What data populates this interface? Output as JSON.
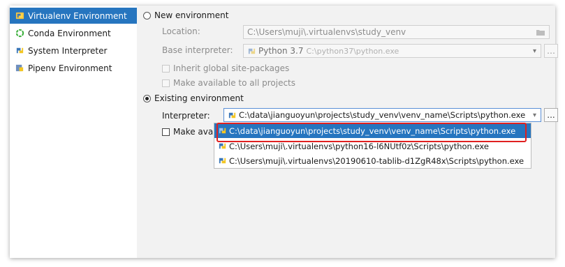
{
  "sidebar": {
    "items": [
      {
        "label": "Virtualenv Environment",
        "icon": "virtualenv-icon",
        "selected": true
      },
      {
        "label": "Conda Environment",
        "icon": "conda-icon",
        "selected": false
      },
      {
        "label": "System Interpreter",
        "icon": "python-icon",
        "selected": false
      },
      {
        "label": "Pipenv Environment",
        "icon": "pipenv-icon",
        "selected": false
      }
    ]
  },
  "new_env": {
    "label": "New environment",
    "location_label": "Location:",
    "location_value": "C:\\Users\\muji\\.virtualenvs\\study_venv",
    "base_label": "Base interpreter:",
    "base_value_name": "Python 3.7",
    "base_value_path": "C:\\python37\\python.exe",
    "inherit_label": "Inherit global site-packages",
    "available_label": "Make available to all projects"
  },
  "existing_env": {
    "label": "Existing environment",
    "interpreter_label": "Interpreter:",
    "interpreter_value": "C:\\data\\jianguoyun\\projects\\study_venv\\venv_name\\Scripts\\python.exe",
    "make_available_label": "Make avail",
    "browse_label": "..."
  },
  "dropdown": {
    "options": [
      "C:\\data\\jianguoyun\\projects\\study_venv\\venv_name\\Scripts\\python.exe",
      "C:\\Users\\muji\\.virtualenvs\\python16-l6NUtf0z\\Scripts\\python.exe",
      "C:\\Users\\muji\\.virtualenvs\\20190610-tablib-d1ZgR48x\\Scripts\\python.exe"
    ]
  },
  "colors": {
    "accent": "#2675bf",
    "highlight": "#e02020"
  }
}
